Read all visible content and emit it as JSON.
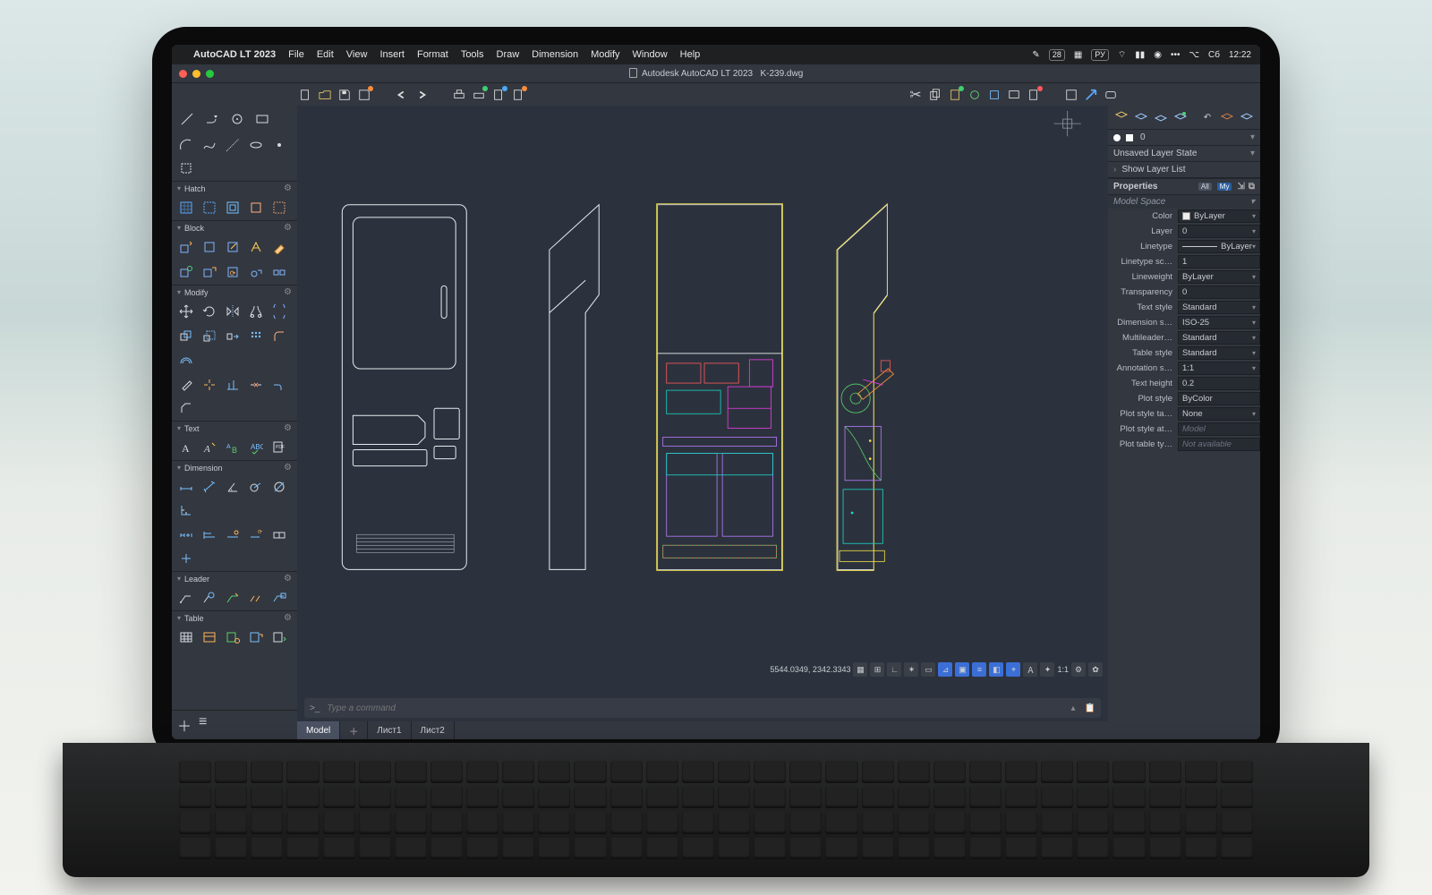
{
  "menubar": {
    "app": "AutoCAD LT 2023",
    "items": [
      "File",
      "Edit",
      "View",
      "Insert",
      "Format",
      "Tools",
      "Draw",
      "Dimension",
      "Modify",
      "Window",
      "Help"
    ],
    "right": {
      "date": "28",
      "lang": "РУ",
      "day": "Сб",
      "time": "12:22"
    }
  },
  "titlebar": {
    "title": "Autodesk AutoCAD LT 2023",
    "doc": "K-239.dwg"
  },
  "palette": {
    "sections": [
      "Hatch",
      "Block",
      "Modify",
      "Text",
      "Dimension",
      "Leader",
      "Table"
    ]
  },
  "tabs": {
    "active": "Model",
    "items": [
      "Лист1",
      "Лист2"
    ]
  },
  "command": {
    "prompt": ">_",
    "placeholder": "Type a command"
  },
  "status": {
    "coords": "5544.0349, 2342.3343",
    "scale": "1:1"
  },
  "layers": {
    "state": "Unsaved Layer State",
    "list_label": "Show Layer List",
    "color_marker": "0"
  },
  "properties": {
    "title": "Properties",
    "tags": [
      "All",
      "My"
    ],
    "subhead": "Model Space",
    "rows": [
      {
        "label": "Color",
        "value": "ByLayer",
        "type": "color"
      },
      {
        "label": "Layer",
        "value": "0",
        "type": "select"
      },
      {
        "label": "Linetype",
        "value": "ByLayer",
        "type": "linetype"
      },
      {
        "label": "Linetype sc…",
        "value": "1",
        "type": "text"
      },
      {
        "label": "Lineweight",
        "value": "ByLayer",
        "type": "select"
      },
      {
        "label": "Transparency",
        "value": "0",
        "type": "text"
      },
      {
        "label": "Text style",
        "value": "Standard",
        "type": "select"
      },
      {
        "label": "Dimension s…",
        "value": "ISO-25",
        "type": "select"
      },
      {
        "label": "Multileader…",
        "value": "Standard",
        "type": "select"
      },
      {
        "label": "Table style",
        "value": "Standard",
        "type": "select"
      },
      {
        "label": "Annotation s…",
        "value": "1:1",
        "type": "select"
      },
      {
        "label": "Text height",
        "value": "0.2",
        "type": "text"
      },
      {
        "label": "Plot style",
        "value": "ByColor",
        "type": "readonly"
      },
      {
        "label": "Plot style ta…",
        "value": "None",
        "type": "select"
      },
      {
        "label": "Plot style at…",
        "value": "Model",
        "type": "dim"
      },
      {
        "label": "Plot table ty…",
        "value": "Not available",
        "type": "dim"
      }
    ]
  }
}
